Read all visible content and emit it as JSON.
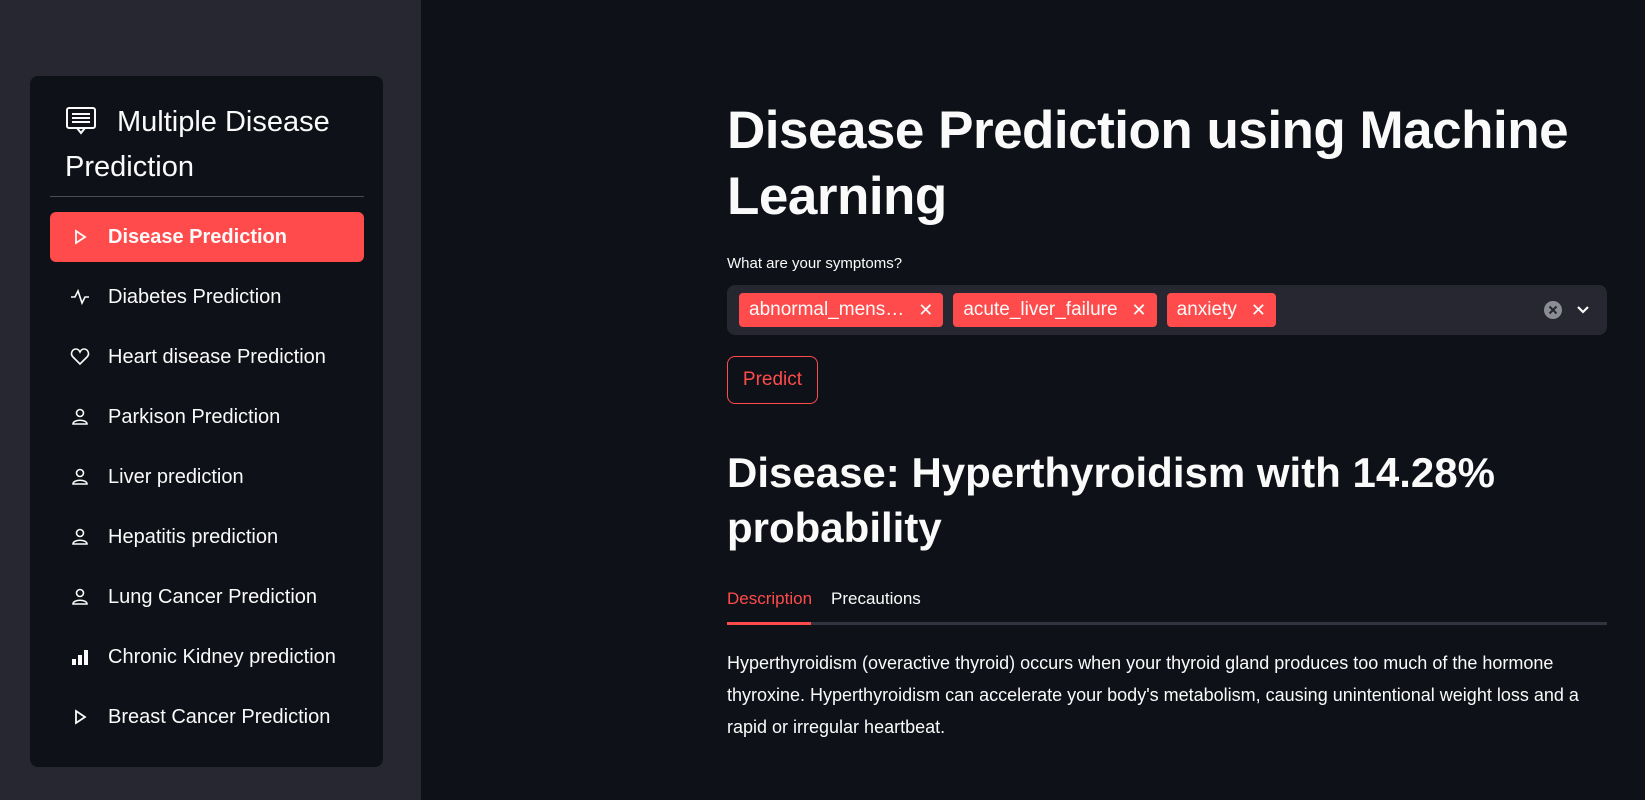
{
  "sidebar": {
    "title": "Multiple Disease Prediction",
    "title_icon": "list-icon",
    "items": [
      {
        "label": "Disease Prediction",
        "icon": "play-icon",
        "active": true
      },
      {
        "label": "Diabetes Prediction",
        "icon": "activity-icon"
      },
      {
        "label": "Heart disease Prediction",
        "icon": "heart-icon"
      },
      {
        "label": "Parkison Prediction",
        "icon": "person-icon"
      },
      {
        "label": "Liver prediction",
        "icon": "person-icon"
      },
      {
        "label": "Hepatitis prediction",
        "icon": "person-icon"
      },
      {
        "label": "Lung Cancer Prediction",
        "icon": "person-icon"
      },
      {
        "label": "Chronic Kidney prediction",
        "icon": "bar-chart-icon"
      },
      {
        "label": "Breast Cancer Prediction",
        "icon": "play-icon"
      }
    ]
  },
  "main": {
    "title": "Disease Prediction using Machine Learning",
    "symptoms_label": "What are your symptoms?",
    "selected_symptoms": [
      "abnormal_mens…",
      "acute_liver_failure",
      "anxiety"
    ],
    "predict_label": "Predict",
    "result": "Disease: Hyperthyroidism with 14.28% probability",
    "tabs": [
      {
        "label": "Description",
        "active": true
      },
      {
        "label": "Precautions",
        "active": false
      }
    ],
    "description": "Hyperthyroidism (overactive thyroid) occurs when your thyroid gland produces too much of the hormone thyroxine. Hyperthyroidism can accelerate your body's metabolism, causing unintentional weight loss and a rapid or irregular heartbeat."
  },
  "colors": {
    "accent": "#ff4b4b",
    "background": "#0e1117",
    "sidebar": "#262730"
  }
}
